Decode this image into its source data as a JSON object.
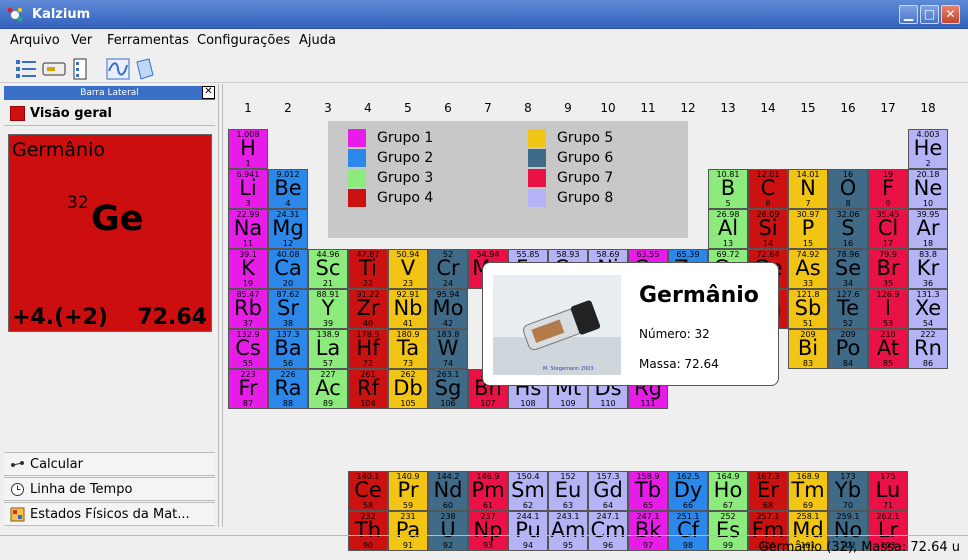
{
  "window": {
    "title": "Kalzium"
  },
  "menu": [
    "Arquivo",
    "Ver",
    "Ferramentas",
    "Configurações",
    "Ajuda"
  ],
  "sidebar": {
    "header": "Barra Lateral",
    "tab_overview": "Visão geral",
    "bottom_tabs": [
      "Calcular",
      "Linha de Tempo",
      "Estados Físicos da Mat..."
    ]
  },
  "info_card": {
    "name": "Germânio",
    "number": "32",
    "symbol": "Ge",
    "oxidation": "+4.(+2)",
    "mass": "72.64"
  },
  "table": {
    "group_headers": [
      "1",
      "2",
      "3",
      "4",
      "5",
      "6",
      "7",
      "8",
      "9",
      "10",
      "11",
      "12",
      "13",
      "14",
      "15",
      "16",
      "17",
      "18"
    ],
    "colors": {
      "g1": "#e81ce8",
      "g2": "#2b88ea",
      "g3": "#8ceb7c",
      "g4": "#cc1111",
      "g5": "#f2c414",
      "g6": "#3f6a88",
      "g7": "#ea1147",
      "g8": "#b3b3f6"
    },
    "elements": [
      {
        "sym": "H",
        "num": "1",
        "mass": "1.008",
        "g": "g1",
        "col": 1,
        "row": 1
      },
      {
        "sym": "He",
        "num": "2",
        "mass": "4.003",
        "g": "g8",
        "col": 18,
        "row": 1
      },
      {
        "sym": "Li",
        "num": "3",
        "mass": "6.941",
        "g": "g1",
        "col": 1,
        "row": 2
      },
      {
        "sym": "Be",
        "num": "4",
        "mass": "9.012",
        "g": "g2",
        "col": 2,
        "row": 2
      },
      {
        "sym": "B",
        "num": "5",
        "mass": "10.81",
        "g": "g3",
        "col": 13,
        "row": 2
      },
      {
        "sym": "C",
        "num": "6",
        "mass": "12.01",
        "g": "g4",
        "col": 14,
        "row": 2
      },
      {
        "sym": "N",
        "num": "7",
        "mass": "14.01",
        "g": "g5",
        "col": 15,
        "row": 2
      },
      {
        "sym": "O",
        "num": "8",
        "mass": "16",
        "g": "g6",
        "col": 16,
        "row": 2
      },
      {
        "sym": "F",
        "num": "9",
        "mass": "19",
        "g": "g7",
        "col": 17,
        "row": 2
      },
      {
        "sym": "Ne",
        "num": "10",
        "mass": "20.18",
        "g": "g8",
        "col": 18,
        "row": 2
      },
      {
        "sym": "Na",
        "num": "11",
        "mass": "22.99",
        "g": "g1",
        "col": 1,
        "row": 3
      },
      {
        "sym": "Mg",
        "num": "12",
        "mass": "24.31",
        "g": "g2",
        "col": 2,
        "row": 3
      },
      {
        "sym": "Al",
        "num": "13",
        "mass": "26.98",
        "g": "g3",
        "col": 13,
        "row": 3
      },
      {
        "sym": "Si",
        "num": "14",
        "mass": "28.09",
        "g": "g4",
        "col": 14,
        "row": 3
      },
      {
        "sym": "P",
        "num": "15",
        "mass": "30.97",
        "g": "g5",
        "col": 15,
        "row": 3
      },
      {
        "sym": "S",
        "num": "16",
        "mass": "32.06",
        "g": "g6",
        "col": 16,
        "row": 3
      },
      {
        "sym": "Cl",
        "num": "17",
        "mass": "35.45",
        "g": "g7",
        "col": 17,
        "row": 3
      },
      {
        "sym": "Ar",
        "num": "18",
        "mass": "39.95",
        "g": "g8",
        "col": 18,
        "row": 3
      },
      {
        "sym": "K",
        "num": "19",
        "mass": "39.1",
        "g": "g1",
        "col": 1,
        "row": 4
      },
      {
        "sym": "Ca",
        "num": "20",
        "mass": "40.08",
        "g": "g2",
        "col": 2,
        "row": 4
      },
      {
        "sym": "Sc",
        "num": "21",
        "mass": "44.96",
        "g": "g3",
        "col": 3,
        "row": 4
      },
      {
        "sym": "Ti",
        "num": "22",
        "mass": "47.87",
        "g": "g4",
        "col": 4,
        "row": 4
      },
      {
        "sym": "V",
        "num": "23",
        "mass": "50.94",
        "g": "g5",
        "col": 5,
        "row": 4
      },
      {
        "sym": "Cr",
        "num": "24",
        "mass": "52",
        "g": "g6",
        "col": 6,
        "row": 4
      },
      {
        "sym": "Mn",
        "num": "25",
        "mass": "54.94",
        "g": "g7",
        "col": 7,
        "row": 4
      },
      {
        "sym": "Fe",
        "num": "26",
        "mass": "55.85",
        "g": "g8",
        "col": 8,
        "row": 4
      },
      {
        "sym": "Co",
        "num": "27",
        "mass": "58.93",
        "g": "g8",
        "col": 9,
        "row": 4
      },
      {
        "sym": "Ni",
        "num": "28",
        "mass": "58.69",
        "g": "g8",
        "col": 10,
        "row": 4
      },
      {
        "sym": "Cu",
        "num": "29",
        "mass": "63.55",
        "g": "g1",
        "col": 11,
        "row": 4
      },
      {
        "sym": "Zn",
        "num": "30",
        "mass": "65.39",
        "g": "g2",
        "col": 12,
        "row": 4
      },
      {
        "sym": "Ga",
        "num": "31",
        "mass": "69.72",
        "g": "g3",
        "col": 13,
        "row": 4
      },
      {
        "sym": "Ge",
        "num": "32",
        "mass": "72.64",
        "g": "g4",
        "col": 14,
        "row": 4
      },
      {
        "sym": "As",
        "num": "33",
        "mass": "74.92",
        "g": "g5",
        "col": 15,
        "row": 4
      },
      {
        "sym": "Se",
        "num": "34",
        "mass": "78.96",
        "g": "g6",
        "col": 16,
        "row": 4
      },
      {
        "sym": "Br",
        "num": "35",
        "mass": "79.9",
        "g": "g7",
        "col": 17,
        "row": 4
      },
      {
        "sym": "Kr",
        "num": "36",
        "mass": "83.8",
        "g": "g8",
        "col": 18,
        "row": 4
      },
      {
        "sym": "Rb",
        "num": "37",
        "mass": "85.47",
        "g": "g1",
        "col": 1,
        "row": 5
      },
      {
        "sym": "Sr",
        "num": "38",
        "mass": "87.62",
        "g": "g2",
        "col": 2,
        "row": 5
      },
      {
        "sym": "Y",
        "num": "39",
        "mass": "88.91",
        "g": "g3",
        "col": 3,
        "row": 5
      },
      {
        "sym": "Zr",
        "num": "40",
        "mass": "91.22",
        "g": "g4",
        "col": 4,
        "row": 5
      },
      {
        "sym": "Nb",
        "num": "41",
        "mass": "92.91",
        "g": "g5",
        "col": 5,
        "row": 5
      },
      {
        "sym": "Mo",
        "num": "42",
        "mass": "95.94",
        "g": "g6",
        "col": 6,
        "row": 5
      },
      {
        "sym": "Sn",
        "num": "50",
        "mass": "118.7",
        "g": "g4",
        "col": 14,
        "row": 5
      },
      {
        "sym": "Sb",
        "num": "51",
        "mass": "121.8",
        "g": "g5",
        "col": 15,
        "row": 5
      },
      {
        "sym": "Te",
        "num": "52",
        "mass": "127.6",
        "g": "g6",
        "col": 16,
        "row": 5
      },
      {
        "sym": "I",
        "num": "53",
        "mass": "126.9",
        "g": "g7",
        "col": 17,
        "row": 5
      },
      {
        "sym": "Xe",
        "num": "54",
        "mass": "131.3",
        "g": "g8",
        "col": 18,
        "row": 5
      },
      {
        "sym": "Cs",
        "num": "55",
        "mass": "132.9",
        "g": "g1",
        "col": 1,
        "row": 6
      },
      {
        "sym": "Ba",
        "num": "56",
        "mass": "137.3",
        "g": "g2",
        "col": 2,
        "row": 6
      },
      {
        "sym": "La",
        "num": "57",
        "mass": "138.9",
        "g": "g3",
        "col": 3,
        "row": 6
      },
      {
        "sym": "Hf",
        "num": "72",
        "mass": "178.5",
        "g": "g4",
        "col": 4,
        "row": 6
      },
      {
        "sym": "Ta",
        "num": "73",
        "mass": "180.9",
        "g": "g5",
        "col": 5,
        "row": 6
      },
      {
        "sym": "W",
        "num": "74",
        "mass": "183.8",
        "g": "g6",
        "col": 6,
        "row": 6
      },
      {
        "sym": "Bi",
        "num": "83",
        "mass": "209",
        "g": "g5",
        "col": 15,
        "row": 6
      },
      {
        "sym": "Po",
        "num": "84",
        "mass": "209",
        "g": "g6",
        "col": 16,
        "row": 6
      },
      {
        "sym": "At",
        "num": "85",
        "mass": "210",
        "g": "g7",
        "col": 17,
        "row": 6
      },
      {
        "sym": "Rn",
        "num": "86",
        "mass": "222",
        "g": "g8",
        "col": 18,
        "row": 6
      },
      {
        "sym": "Fr",
        "num": "87",
        "mass": "223",
        "g": "g1",
        "col": 1,
        "row": 7
      },
      {
        "sym": "Ra",
        "num": "88",
        "mass": "226",
        "g": "g2",
        "col": 2,
        "row": 7
      },
      {
        "sym": "Ac",
        "num": "89",
        "mass": "227",
        "g": "g3",
        "col": 3,
        "row": 7
      },
      {
        "sym": "Rf",
        "num": "104",
        "mass": "261",
        "g": "g4",
        "col": 4,
        "row": 7
      },
      {
        "sym": "Db",
        "num": "105",
        "mass": "262",
        "g": "g5",
        "col": 5,
        "row": 7
      },
      {
        "sym": "Sg",
        "num": "106",
        "mass": "263.1",
        "g": "g6",
        "col": 6,
        "row": 7
      },
      {
        "sym": "Bh",
        "num": "107",
        "mass": "264",
        "g": "g7",
        "col": 7,
        "row": 7
      },
      {
        "sym": "Hs",
        "num": "108",
        "mass": "265",
        "g": "g8",
        "col": 8,
        "row": 7
      },
      {
        "sym": "Mt",
        "num": "109",
        "mass": "268",
        "g": "g8",
        "col": 9,
        "row": 7
      },
      {
        "sym": "Ds",
        "num": "110",
        "mass": "281",
        "g": "g8",
        "col": 10,
        "row": 7
      },
      {
        "sym": "Rg",
        "num": "111",
        "mass": "272",
        "g": "g1",
        "col": 11,
        "row": 7
      },
      {
        "sym": "Ce",
        "num": "58",
        "mass": "140.1",
        "g": "g4",
        "col": 4,
        "row": 9
      },
      {
        "sym": "Pr",
        "num": "59",
        "mass": "140.9",
        "g": "g5",
        "col": 5,
        "row": 9
      },
      {
        "sym": "Nd",
        "num": "60",
        "mass": "144.2",
        "g": "g6",
        "col": 6,
        "row": 9
      },
      {
        "sym": "Pm",
        "num": "61",
        "mass": "146.9",
        "g": "g7",
        "col": 7,
        "row": 9
      },
      {
        "sym": "Sm",
        "num": "62",
        "mass": "150.4",
        "g": "g8",
        "col": 8,
        "row": 9
      },
      {
        "sym": "Eu",
        "num": "63",
        "mass": "152",
        "g": "g8",
        "col": 9,
        "row": 9
      },
      {
        "sym": "Gd",
        "num": "64",
        "mass": "157.3",
        "g": "g8",
        "col": 10,
        "row": 9
      },
      {
        "sym": "Tb",
        "num": "65",
        "mass": "158.9",
        "g": "g1",
        "col": 11,
        "row": 9
      },
      {
        "sym": "Dy",
        "num": "66",
        "mass": "162.5",
        "g": "g2",
        "col": 12,
        "row": 9
      },
      {
        "sym": "Ho",
        "num": "67",
        "mass": "164.9",
        "g": "g3",
        "col": 13,
        "row": 9
      },
      {
        "sym": "Er",
        "num": "68",
        "mass": "167.3",
        "g": "g4",
        "col": 14,
        "row": 9
      },
      {
        "sym": "Tm",
        "num": "69",
        "mass": "168.9",
        "g": "g5",
        "col": 15,
        "row": 9
      },
      {
        "sym": "Yb",
        "num": "70",
        "mass": "173",
        "g": "g6",
        "col": 16,
        "row": 9
      },
      {
        "sym": "Lu",
        "num": "71",
        "mass": "175",
        "g": "g7",
        "col": 17,
        "row": 9
      },
      {
        "sym": "Th",
        "num": "90",
        "mass": "232",
        "g": "g4",
        "col": 4,
        "row": 10
      },
      {
        "sym": "Pa",
        "num": "91",
        "mass": "231",
        "g": "g5",
        "col": 5,
        "row": 10
      },
      {
        "sym": "U",
        "num": "92",
        "mass": "238",
        "g": "g6",
        "col": 6,
        "row": 10
      },
      {
        "sym": "Np",
        "num": "93",
        "mass": "237",
        "g": "g7",
        "col": 7,
        "row": 10
      },
      {
        "sym": "Pu",
        "num": "94",
        "mass": "244.1",
        "g": "g8",
        "col": 8,
        "row": 10
      },
      {
        "sym": "Am",
        "num": "95",
        "mass": "243.1",
        "g": "g8",
        "col": 9,
        "row": 10
      },
      {
        "sym": "Cm",
        "num": "96",
        "mass": "247.1",
        "g": "g8",
        "col": 10,
        "row": 10
      },
      {
        "sym": "Bk",
        "num": "97",
        "mass": "247.1",
        "g": "g1",
        "col": 11,
        "row": 10
      },
      {
        "sym": "Cf",
        "num": "98",
        "mass": "251.1",
        "g": "g2",
        "col": 12,
        "row": 10
      },
      {
        "sym": "Es",
        "num": "99",
        "mass": "252",
        "g": "g3",
        "col": 13,
        "row": 10
      },
      {
        "sym": "Fm",
        "num": "100",
        "mass": "257.1",
        "g": "g4",
        "col": 14,
        "row": 10
      },
      {
        "sym": "Md",
        "num": "101",
        "mass": "258.1",
        "g": "g5",
        "col": 15,
        "row": 10
      },
      {
        "sym": "No",
        "num": "102",
        "mass": "259.1",
        "g": "g6",
        "col": 16,
        "row": 10
      },
      {
        "sym": "Lr",
        "num": "103",
        "mass": "262.1",
        "g": "g7",
        "col": 17,
        "row": 10
      }
    ]
  },
  "legend": [
    {
      "label": "Grupo 1",
      "g": "g1"
    },
    {
      "label": "Grupo 2",
      "g": "g2"
    },
    {
      "label": "Grupo 3",
      "g": "g3"
    },
    {
      "label": "Grupo 4",
      "g": "g4"
    },
    {
      "label": "Grupo 5",
      "g": "g5"
    },
    {
      "label": "Grupo 6",
      "g": "g6"
    },
    {
      "label": "Grupo 7",
      "g": "g7"
    },
    {
      "label": "Grupo 8",
      "g": "g8"
    }
  ],
  "tooltip": {
    "name": "Germânio",
    "number_label": "Número: 32",
    "mass_label": "Massa: 72.64",
    "photo_credit": "M. Stegemann 2003"
  },
  "status": "Germânio (32), Massa: 72.64 u"
}
